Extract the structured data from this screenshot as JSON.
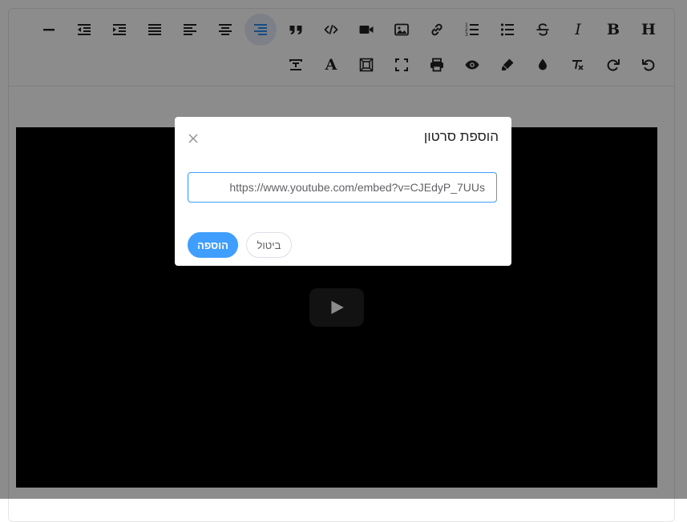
{
  "dialog": {
    "title": "הוספת סרטון",
    "url_value": "https://www.youtube.com/embed?v=CJEdyP_7UUs",
    "add_label": "הוספה",
    "cancel_label": "ביטול"
  },
  "toolbar": {
    "row1": [
      {
        "name": "heading-icon",
        "glyph": "H"
      },
      {
        "name": "bold-icon",
        "glyph": "B"
      },
      {
        "name": "italic-icon",
        "glyph": "I"
      },
      {
        "name": "strikethrough-icon"
      },
      {
        "name": "bullet-list-icon"
      },
      {
        "name": "numbered-list-icon"
      },
      {
        "name": "link-icon"
      },
      {
        "name": "image-icon"
      },
      {
        "name": "video-icon"
      },
      {
        "name": "code-icon"
      },
      {
        "name": "quote-icon"
      },
      {
        "name": "align-right-icon",
        "active": true
      },
      {
        "name": "align-center-icon"
      },
      {
        "name": "align-left-icon"
      },
      {
        "name": "align-justify-icon"
      },
      {
        "name": "indent-icon"
      },
      {
        "name": "outdent-icon"
      },
      {
        "name": "horizontal-rule-icon"
      }
    ],
    "row2": [
      {
        "name": "undo-icon"
      },
      {
        "name": "redo-icon"
      },
      {
        "name": "clear-format-icon"
      },
      {
        "name": "background-color-icon"
      },
      {
        "name": "highlight-icon"
      },
      {
        "name": "preview-icon"
      },
      {
        "name": "print-icon"
      },
      {
        "name": "fullscreen-icon"
      },
      {
        "name": "select-all-icon"
      },
      {
        "name": "font-color-icon",
        "glyph": "A"
      },
      {
        "name": "text-size-icon"
      }
    ],
    "active_color": "#2d8cf0"
  },
  "colors": {
    "primary": "#409eff",
    "overlay": "rgba(0,0,0,0.45)"
  }
}
